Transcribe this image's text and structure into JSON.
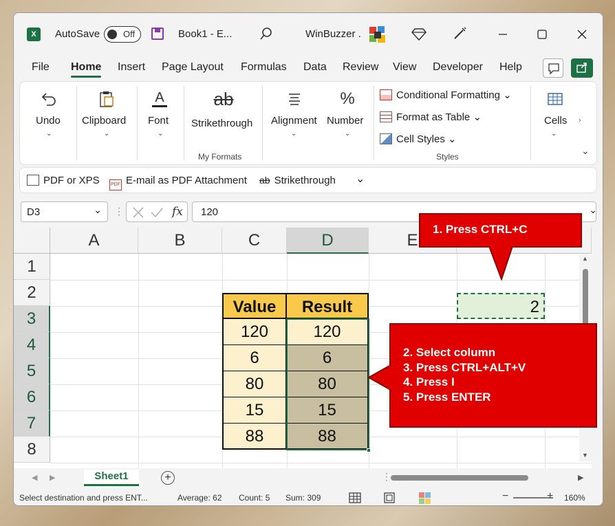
{
  "titlebar": {
    "app_logo": "X",
    "autosave_label": "AutoSave",
    "autosave_state": "Off",
    "document_title": "Book1  -  E...",
    "account_name": "WinBuzzer ."
  },
  "menu": {
    "tabs": [
      "File",
      "Home",
      "Insert",
      "Page Layout",
      "Formulas",
      "Data",
      "Review",
      "View",
      "Developer",
      "Help"
    ],
    "active": "Home"
  },
  "ribbon": {
    "undo": "Undo",
    "clipboard": "Clipboard",
    "font": "Font",
    "font_icon_letter": "A",
    "strikethrough": "Strikethrough",
    "strikethrough_icon": "ab",
    "my_formats_group": "My Formats",
    "alignment": "Alignment",
    "number": "Number",
    "number_icon": "%",
    "conditional_formatting": "Conditional Formatting",
    "format_as_table": "Format as Table",
    "cell_styles": "Cell Styles",
    "styles_group": "Styles",
    "cells": "Cells"
  },
  "qat": {
    "pdf_xps": "PDF or XPS",
    "email_pdf": "E-mail as PDF Attachment",
    "strikethrough": "Strikethrough",
    "strikethrough_icon": "ab",
    "pdf_badge": "PDF"
  },
  "formula_bar": {
    "name_box": "D3",
    "fx": "fx",
    "value": "120"
  },
  "grid": {
    "columns": [
      "A",
      "B",
      "C",
      "D",
      "E"
    ],
    "rows": [
      "1",
      "2",
      "3",
      "4",
      "5",
      "6",
      "7",
      "8"
    ],
    "header_value": "Value",
    "header_result": "Result",
    "values": [
      "120",
      "6",
      "80",
      "15",
      "88"
    ],
    "results": [
      "120",
      "6",
      "80",
      "15",
      "88"
    ],
    "copied_cell": "2"
  },
  "callouts": {
    "first": "1. Press CTRL+C",
    "steps": [
      "2. Select column",
      "3. Press CTRL+ALT+V",
      "4. Press I",
      "5. Press ENTER"
    ]
  },
  "sheets": {
    "tab": "Sheet1"
  },
  "status": {
    "message": "Select destination and press ENT...",
    "average": "Average: 62",
    "count": "Count: 5",
    "sum": "Sum: 309",
    "zoom": "160%"
  },
  "colors": {
    "excel_green": "#1e7145",
    "header_fill": "#f8c94a",
    "value_fill": "#fdf0cc",
    "result_fill": "#c8bfa1",
    "callout_red": "#e00000",
    "copy_fill": "#e2efd9"
  }
}
